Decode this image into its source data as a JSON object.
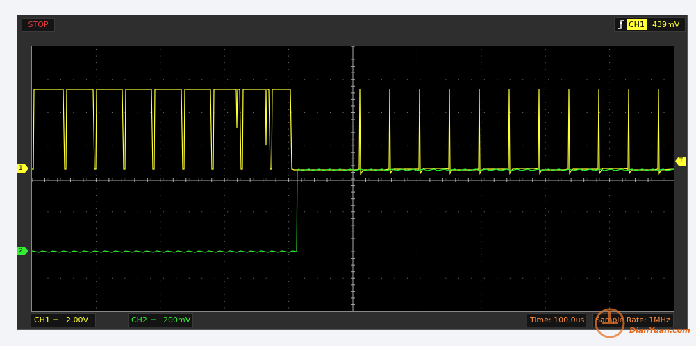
{
  "status": {
    "run_state": "STOP"
  },
  "trigger": {
    "channel": "CH1",
    "level": "439mV",
    "edge": "rising-edge-icon"
  },
  "markers": {
    "ch1": "1",
    "ch2": "2",
    "trigger": "T"
  },
  "channels": [
    {
      "name": "CH1",
      "coupling": "⎓",
      "scale": "2.00V",
      "color": "#ffff33"
    },
    {
      "name": "CH2",
      "coupling": "⎓",
      "scale": "200mV",
      "color": "#33ee33"
    }
  ],
  "timebase": {
    "time": "Time: 100.0us",
    "sample_rate": "Sample Rate: 1MHz"
  },
  "watermark": {
    "site": "DianYuan.com",
    "logo": "dianyuan-logo-icon"
  },
  "colors": {
    "ch1": "#ffff33",
    "ch2": "#33ee33",
    "stop": "#e03a3a",
    "info": "#ff8c3a",
    "screen": "#000000",
    "frame": "#2e2e2e"
  }
}
